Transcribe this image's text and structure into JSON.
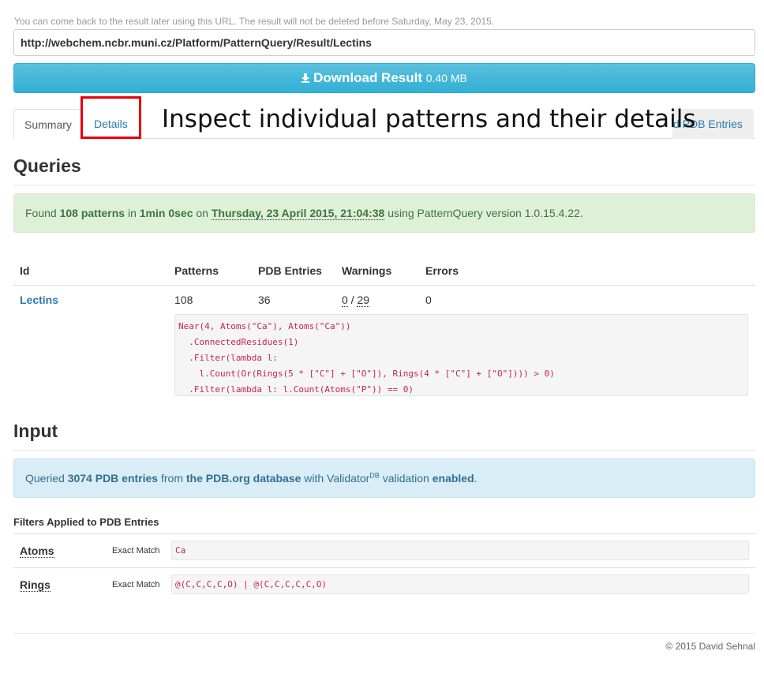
{
  "notice": "You can come back to the result later using this URL. The result will not be deleted before Saturday, May 23, 2015.",
  "url": "http://webchem.ncbr.muni.cz/Platform/PatternQuery/Result/Lectins",
  "download": {
    "label": "Download Result",
    "size": "0.40 MB",
    "icon": "download-icon"
  },
  "tabs": {
    "summary": "Summary",
    "details": "Details",
    "pdb_entries": "d PDB Entries"
  },
  "callout": "Inspect individual patterns and their details",
  "queries": {
    "heading": "Queries",
    "alert": {
      "found": "Found",
      "patterns": "108 patterns",
      "in": "in",
      "time": "1min 0sec",
      "on": "on",
      "date": "Thursday, 23 April 2015, 21:04:38",
      "using": "using PatternQuery version 1.0.15.4.22."
    },
    "columns": [
      "Id",
      "Patterns",
      "PDB Entries",
      "Warnings",
      "Errors"
    ],
    "row": {
      "id": "Lectins",
      "patterns": "108",
      "pdb_entries": "36",
      "warnings_a": "0",
      "warnings_sep": " / ",
      "warnings_b": "29",
      "errors": "0",
      "code": "Near(4, Atoms(\"Ca\"), Atoms(\"Ca\"))\n  .ConnectedResidues(1)\n  .Filter(lambda l:\n    l.Count(Or(Rings(5 * [\"C\"] + [\"O\"]), Rings(4 * [\"C\"] + [\"O\"]))) > 0)\n  .Filter(lambda l: l.Count(Atoms(\"P\")) == 0)"
    }
  },
  "input": {
    "heading": "Input",
    "alert": {
      "queried": "Queried",
      "entries": "3074 PDB entries",
      "from": "from",
      "db": "the PDB.org database",
      "with": "with Validator",
      "sup": "DB",
      "validation": "validation",
      "enabled": "enabled",
      "end": "."
    },
    "filters_title": "Filters Applied to PDB Entries",
    "filters": [
      {
        "name": "Atoms",
        "match": "Exact Match",
        "value": "Ca"
      },
      {
        "name": "Rings",
        "match": "Exact Match",
        "value": "@(C,C,C,C,O) | @(C,C,C,C,C,O)"
      }
    ]
  },
  "footer": "© 2015 David Sehnal"
}
